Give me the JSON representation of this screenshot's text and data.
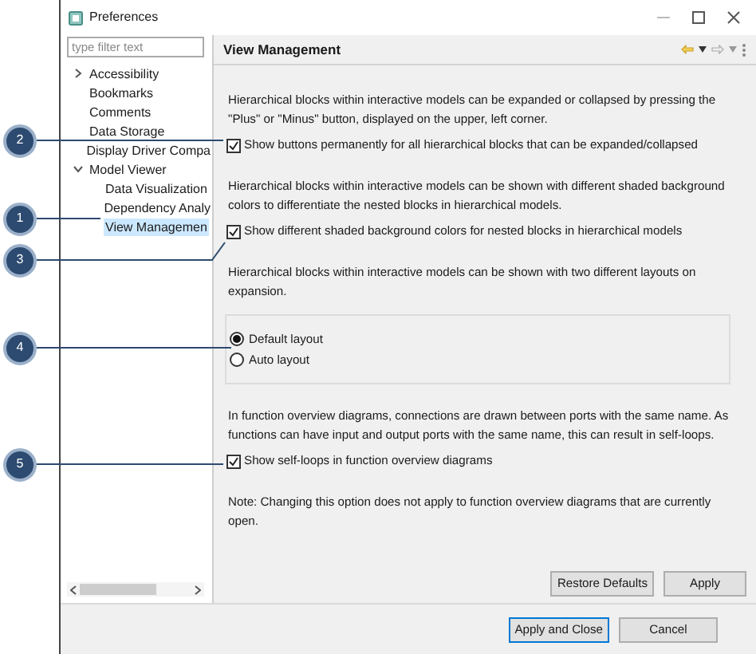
{
  "window": {
    "title": "Preferences"
  },
  "filter": {
    "placeholder": "type filter text"
  },
  "tree": [
    {
      "label": "Accessibility",
      "expanded": false,
      "selected": false
    },
    {
      "label": "Bookmarks",
      "selected": false
    },
    {
      "label": "Comments",
      "selected": false
    },
    {
      "label": "Data Storage",
      "selected": false
    },
    {
      "label": "Display Driver Compa",
      "selected": false
    },
    {
      "label": "Model Viewer",
      "expanded": true,
      "selected": false,
      "children": [
        {
          "label": "Data Visualization",
          "selected": false
        },
        {
          "label": "Dependency Analy",
          "selected": false
        },
        {
          "label": "View Managemen",
          "selected": true
        }
      ]
    }
  ],
  "page_title": "View Management",
  "content": [
    {
      "kind": "paragraph",
      "text": "Hierarchical blocks within interactive models can be expanded or collapsed by pressing the \"Plus\" or \"Minus\" button, displayed on the upper, left corner."
    },
    {
      "kind": "checkbox",
      "label": "Show buttons permanently for all hierarchical blocks that can be expanded/collapsed",
      "checked": true
    },
    {
      "kind": "paragraph",
      "text": "Hierarchical blocks within interactive models can be shown with different shaded background colors to differentiate the nested blocks in hierarchical models."
    },
    {
      "kind": "checkbox",
      "label": "Show different shaded background colors for nested blocks in hierarchical models",
      "checked": true
    },
    {
      "kind": "paragraph",
      "text": "Hierarchical blocks within interactive models can be shown with two different layouts on expansion."
    },
    {
      "kind": "radio_group",
      "options": [
        {
          "label": "Default layout",
          "selected": true
        },
        {
          "label": "Auto layout",
          "selected": false
        }
      ]
    },
    {
      "kind": "paragraph",
      "text": "In function overview diagrams, connections are drawn between ports with the same name. As functions can have input and output ports with the same name, this can result in self-loops."
    },
    {
      "kind": "checkbox",
      "label": "Show self-loops in function overview diagrams",
      "checked": true
    },
    {
      "kind": "paragraph",
      "text": "Note: Changing this option does not apply to function overview diagrams that are currently open."
    }
  ],
  "page_buttons": [
    "Restore Defaults",
    "Apply"
  ],
  "dialog_buttons": [
    {
      "label": "Apply and Close",
      "default": true
    },
    {
      "label": "Cancel",
      "default": false
    }
  ],
  "callouts": [
    "2",
    "1",
    "3",
    "4",
    "5"
  ]
}
